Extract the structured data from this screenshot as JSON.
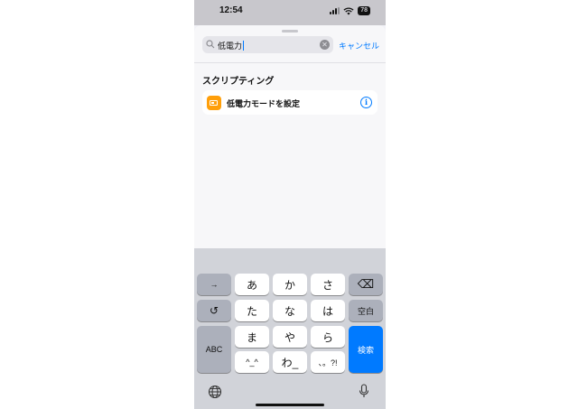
{
  "status_bar": {
    "time": "12:54",
    "battery": "78"
  },
  "search": {
    "query": "低電力",
    "cancel_label": "キャンセル"
  },
  "section_title": "スクリプティング",
  "result": {
    "label": "低電力モードを設定",
    "icon": "battery-icon",
    "accent": "#ff9f0a"
  },
  "keyboard": {
    "keys": {
      "next_arrow": "→",
      "undo": "↺",
      "abc": "ABC",
      "a": "あ",
      "ka": "か",
      "sa": "さ",
      "ta": "た",
      "na": "な",
      "ha": "は",
      "ma": "ま",
      "ya": "や",
      "ra": "ら",
      "kaomoji": "^_^",
      "wa": "わ_",
      "punct": "、。?!",
      "delete": "⌫",
      "space": "空白",
      "search": "検索"
    }
  },
  "colors": {
    "link": "#007aff",
    "key_bg": "#ffffff",
    "kb_bg": "#d1d3d9"
  }
}
